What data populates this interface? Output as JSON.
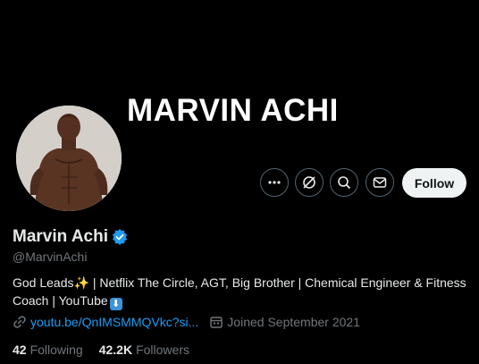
{
  "banner": {
    "title": "MARVIN ACHI"
  },
  "actions": {
    "more": "more-icon",
    "grok": "grok-icon",
    "search": "search-icon",
    "message": "mail-icon",
    "follow_label": "Follow"
  },
  "profile": {
    "name": "Marvin Achi",
    "verified": "verified-badge-icon",
    "handle": "@MarvinAchi",
    "bio_part1": "God Leads",
    "bio_part2": " | Netflix The Circle, AGT, Big Brother | Chemical Engineer & Fitness Coach | YouTube",
    "link": "youtu.be/QnIMSMMQVkc?si...",
    "joined": "Joined September 2021"
  },
  "stats": {
    "following_count": "42",
    "following_label": "Following",
    "followers_count": "42.2K",
    "followers_label": "Followers"
  },
  "colors": {
    "background": "#000000",
    "accent": "#1d9bf0",
    "muted": "#71767b",
    "text": "#e7e9ea"
  }
}
